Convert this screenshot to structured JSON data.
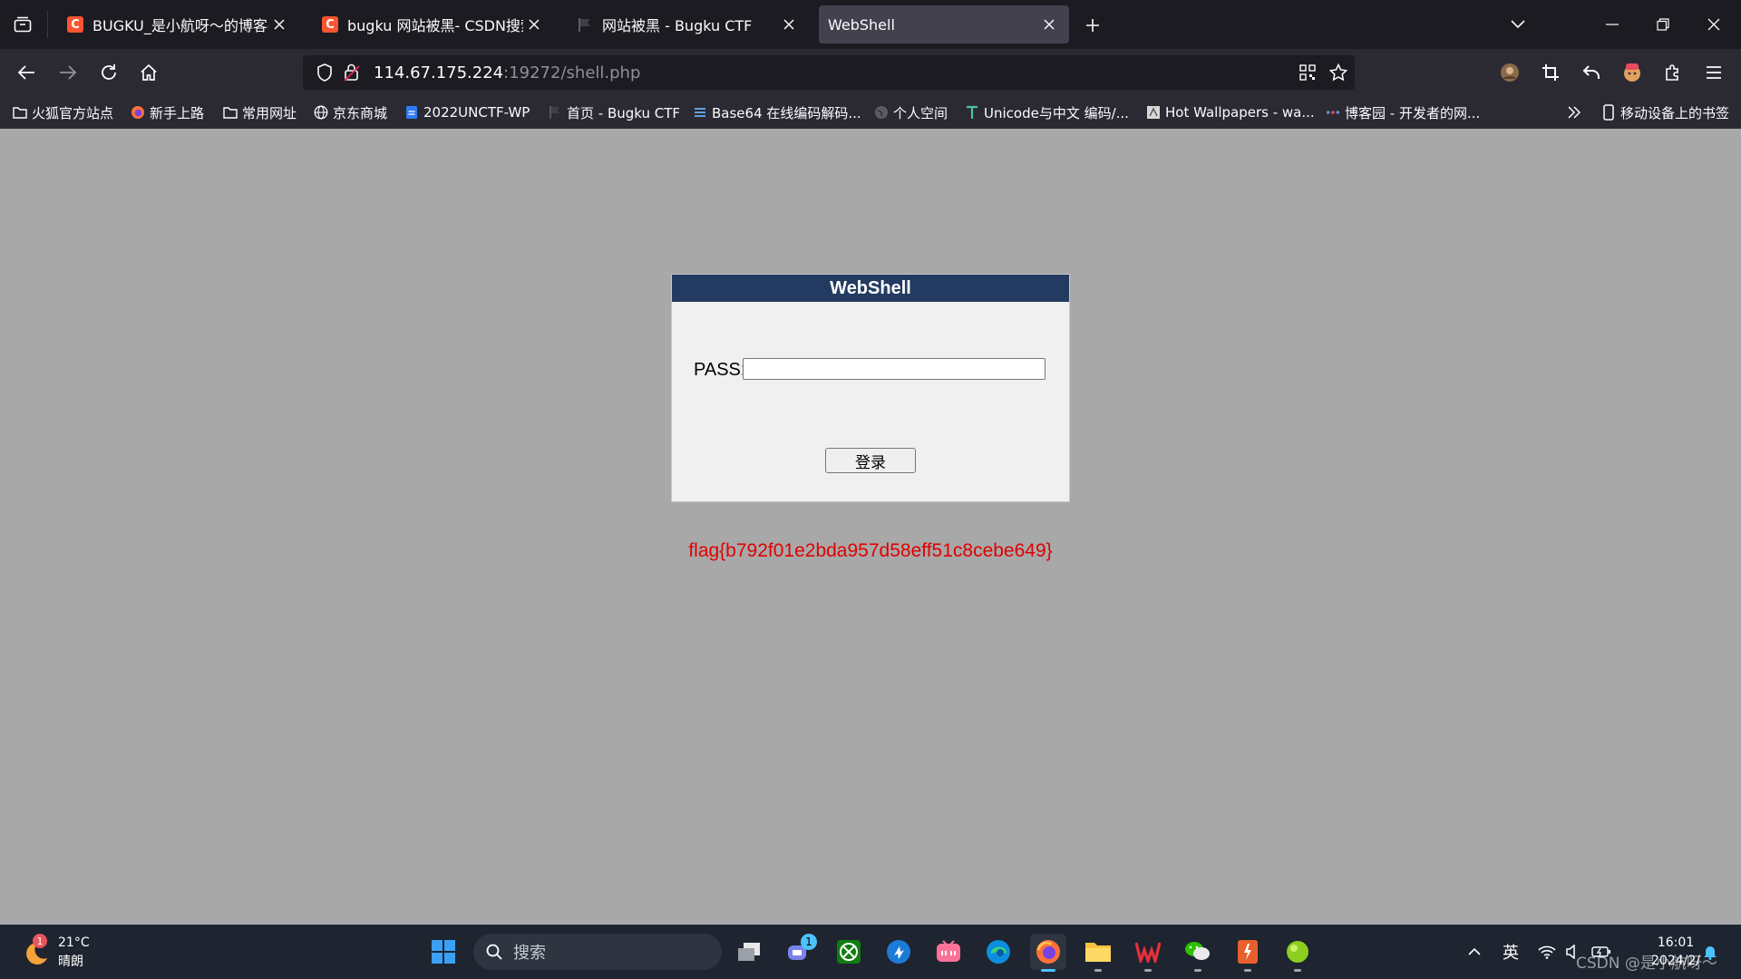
{
  "browser": {
    "tabs": [
      {
        "title": "BUGKU_是小航呀～的博客-CSI",
        "icon": "csdn-favicon",
        "active": false
      },
      {
        "title": "bugku 网站被黑- CSDN搜索",
        "icon": "csdn-favicon",
        "active": false
      },
      {
        "title": "网站被黑 - Bugku CTF",
        "icon": "bugku-favicon",
        "active": false
      },
      {
        "title": "WebShell",
        "icon": "",
        "active": true
      }
    ],
    "url_host": "114.67.175.224",
    "url_path": ":19272/shell.php",
    "bookmarks": [
      {
        "label": "火狐官方站点",
        "icon": "folder-icon"
      },
      {
        "label": "新手上路",
        "icon": "firefox-icon"
      },
      {
        "label": "常用网址",
        "icon": "folder-icon"
      },
      {
        "label": "京东商城",
        "icon": "globe-icon"
      },
      {
        "label": "2022UNCTF-WP",
        "icon": "doc-icon"
      },
      {
        "label": "首页 - Bugku CTF",
        "icon": "bugku-favicon"
      },
      {
        "label": "Base64 在线编码解码...",
        "icon": "base64-icon"
      },
      {
        "label": "个人空间",
        "icon": "globe-grey-icon"
      },
      {
        "label": "Unicode与中文 编码/...",
        "icon": "unicode-icon"
      },
      {
        "label": "Hot Wallpapers - wa...",
        "icon": "wallpaper-icon"
      },
      {
        "label": "博客园 - 开发者的网...",
        "icon": "cnblogs-icon"
      }
    ],
    "mobile_bookmarks": "移动设备上的书签"
  },
  "page": {
    "box_title": "WebShell",
    "pass_label": "PASS:",
    "pass_value": "",
    "login_button": "登录",
    "flag": "flag{b792f01e2bda957d58eff51c8cebe649}"
  },
  "taskbar": {
    "weather_temp": "21°C",
    "weather_desc": "晴朗",
    "weather_badge": "1",
    "search_placeholder": "搜索",
    "chat_badge": "1",
    "input_method": "英",
    "clock_time": "16:01",
    "clock_date": "2024/2/"
  },
  "watermark": "CSDN @是小航呀～",
  "colors": {
    "page_bg": "#a8a8a8",
    "header_bg": "#243b61",
    "flag_color": "#e00000",
    "browser_bg": "#2b2a33",
    "tabstrip_bg": "#1c1b22"
  }
}
